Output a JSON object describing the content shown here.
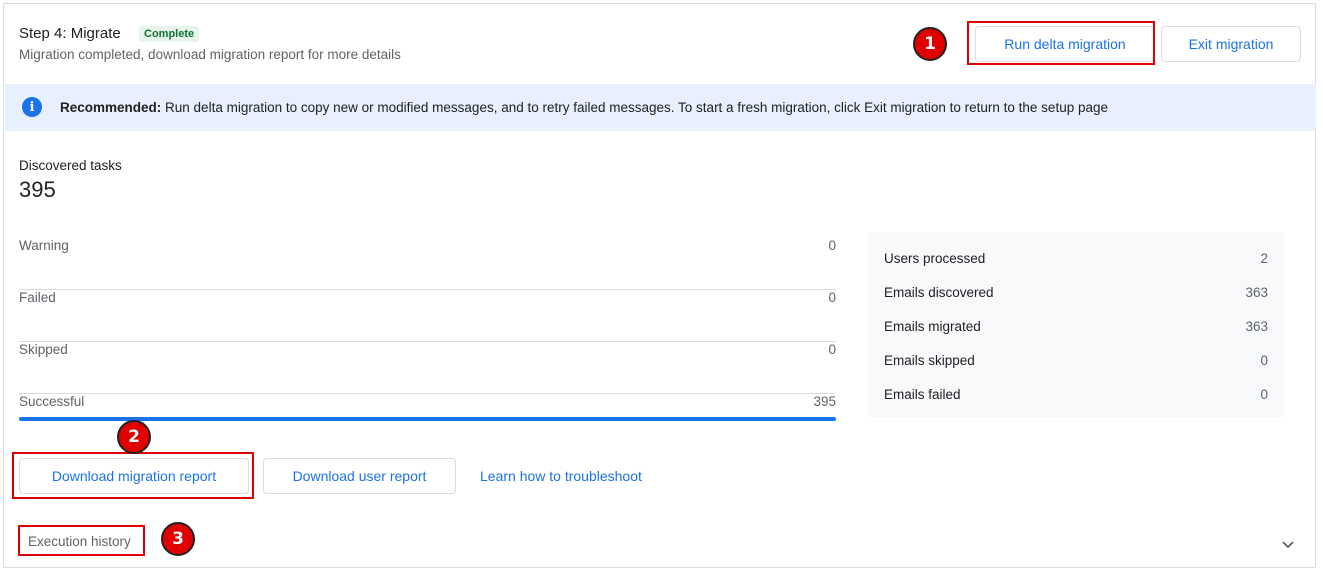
{
  "header": {
    "title": "Step 4: Migrate",
    "status_badge": "Complete",
    "subtitle": "Migration completed, download migration report for more details",
    "run_delta_label": "Run delta migration",
    "exit_label": "Exit migration"
  },
  "banner": {
    "icon": "info-icon",
    "bold_prefix": "Recommended:",
    "message": " Run delta migration to copy new or modified messages, and to retry failed messages. To start a fresh migration, click Exit migration to return to the setup page"
  },
  "discovered": {
    "label": "Discovered tasks",
    "value": "395"
  },
  "stats": [
    {
      "label": "Warning",
      "value": "0"
    },
    {
      "label": "Failed",
      "value": "0"
    },
    {
      "label": "Skipped",
      "value": "0"
    },
    {
      "label": "Successful",
      "value": "395"
    }
  ],
  "progress": {
    "successful_fraction": 1.0,
    "color": "#1a73e8"
  },
  "summary": [
    {
      "label": "Users processed",
      "value": "2"
    },
    {
      "label": "Emails discovered",
      "value": "363"
    },
    {
      "label": "Emails migrated",
      "value": "363"
    },
    {
      "label": "Emails skipped",
      "value": "0"
    },
    {
      "label": "Emails failed",
      "value": "0"
    }
  ],
  "actions": {
    "download_migration_report": "Download migration report",
    "download_user_report": "Download user report",
    "troubleshoot_link": "Learn how to troubleshoot"
  },
  "execution_history": {
    "label": "Execution history",
    "expand_icon": "chevron-down-icon"
  },
  "annotations": {
    "color": "#e00000",
    "steps": [
      "1",
      "2",
      "3"
    ]
  }
}
